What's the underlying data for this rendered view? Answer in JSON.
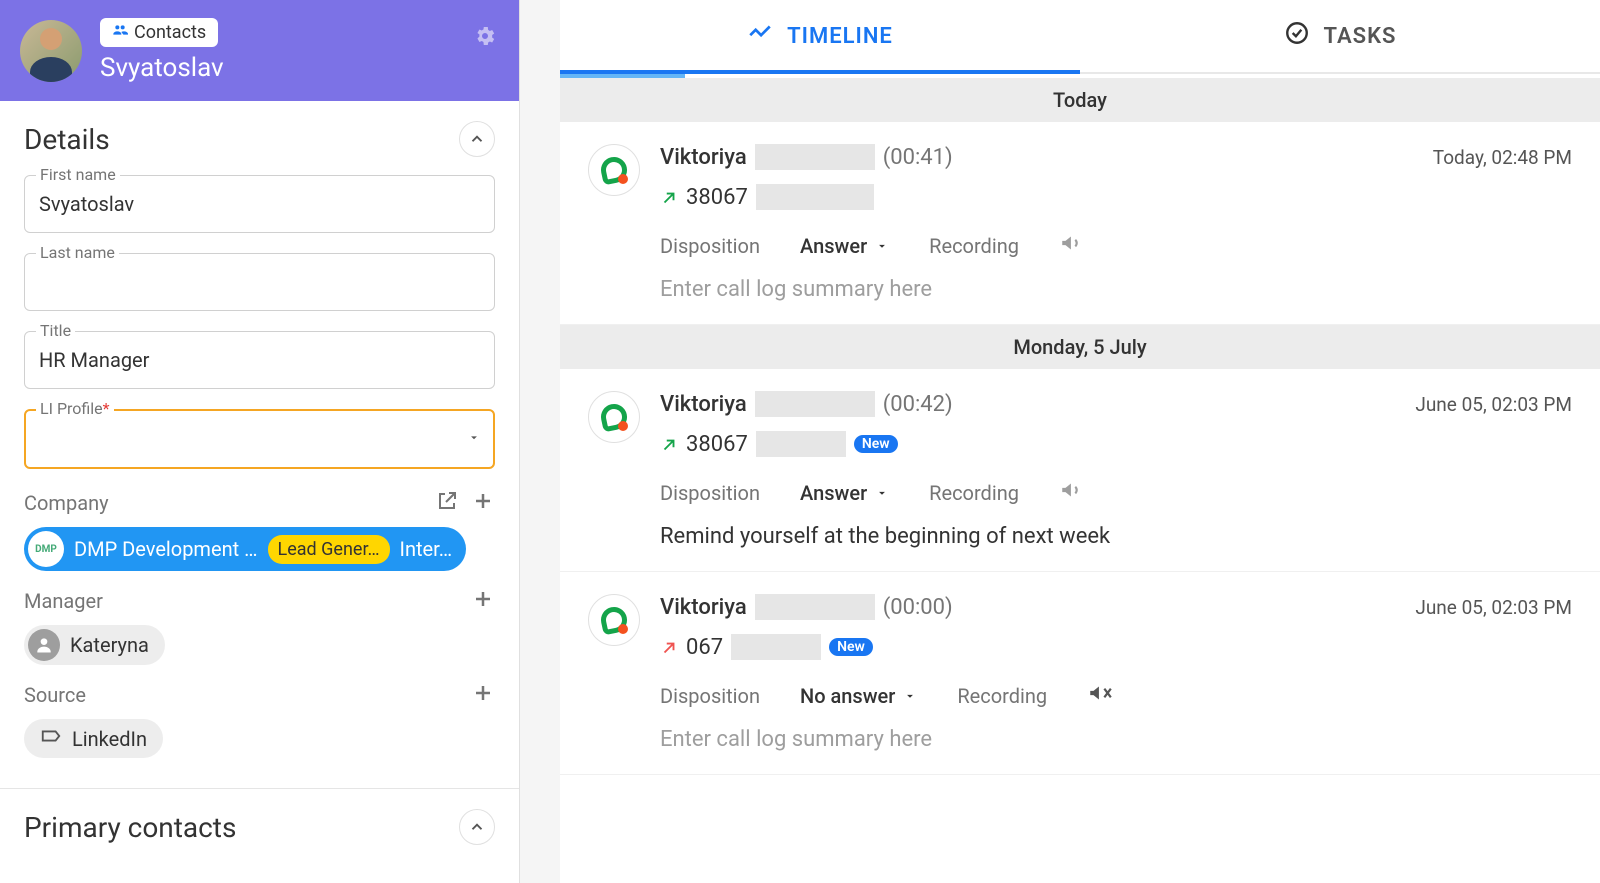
{
  "header": {
    "contacts_label": "Contacts",
    "name": "Svyatoslav"
  },
  "details": {
    "title": "Details",
    "first_name_label": "First name",
    "first_name_value": "Svyatoslav",
    "last_name_label": "Last name",
    "last_name_value": "",
    "title_label": "Title",
    "title_value": "HR Manager",
    "li_profile_label": "LI Profile",
    "li_profile_value": "",
    "company_label": "Company",
    "company_name": "DMP Development …",
    "company_logo_text": "DMP",
    "company_tag": "Lead Gener…",
    "company_extra": "Inter…",
    "manager_label": "Manager",
    "manager_name": "Kateryna",
    "source_label": "Source",
    "source_value": "LinkedIn",
    "primary_contacts_title": "Primary contacts"
  },
  "tabs": {
    "timeline": "TIMELINE",
    "tasks": "TASKS"
  },
  "timeline_labels": {
    "disposition": "Disposition",
    "recording": "Recording",
    "call_log_placeholder": "Enter call log summary here"
  },
  "timeline_groups": [
    {
      "sep": "Today"
    },
    {
      "sep": "Monday, 5 July"
    }
  ],
  "entries": [
    {
      "who": "Viktoriya",
      "duration": "(00:41)",
      "date": "Today, 02:48 PM",
      "phone_prefix": "38067",
      "direction": "out",
      "is_new": false,
      "disposition": "Answer",
      "recording_state": "available",
      "summary": "",
      "summary_placeholder": true
    },
    {
      "who": "Viktoriya",
      "duration": "(00:42)",
      "date": "June 05, 02:03 PM",
      "phone_prefix": "38067",
      "direction": "out",
      "is_new": true,
      "new_label": "New",
      "disposition": "Answer",
      "recording_state": "available",
      "summary": "Remind yourself at the beginning of next week",
      "summary_placeholder": false
    },
    {
      "who": "Viktoriya",
      "duration": "(00:00)",
      "date": "June 05, 02:03 PM",
      "phone_prefix": "067",
      "direction": "miss",
      "is_new": true,
      "new_label": "New",
      "disposition": "No answer",
      "recording_state": "muted",
      "summary": "",
      "summary_placeholder": true
    }
  ]
}
